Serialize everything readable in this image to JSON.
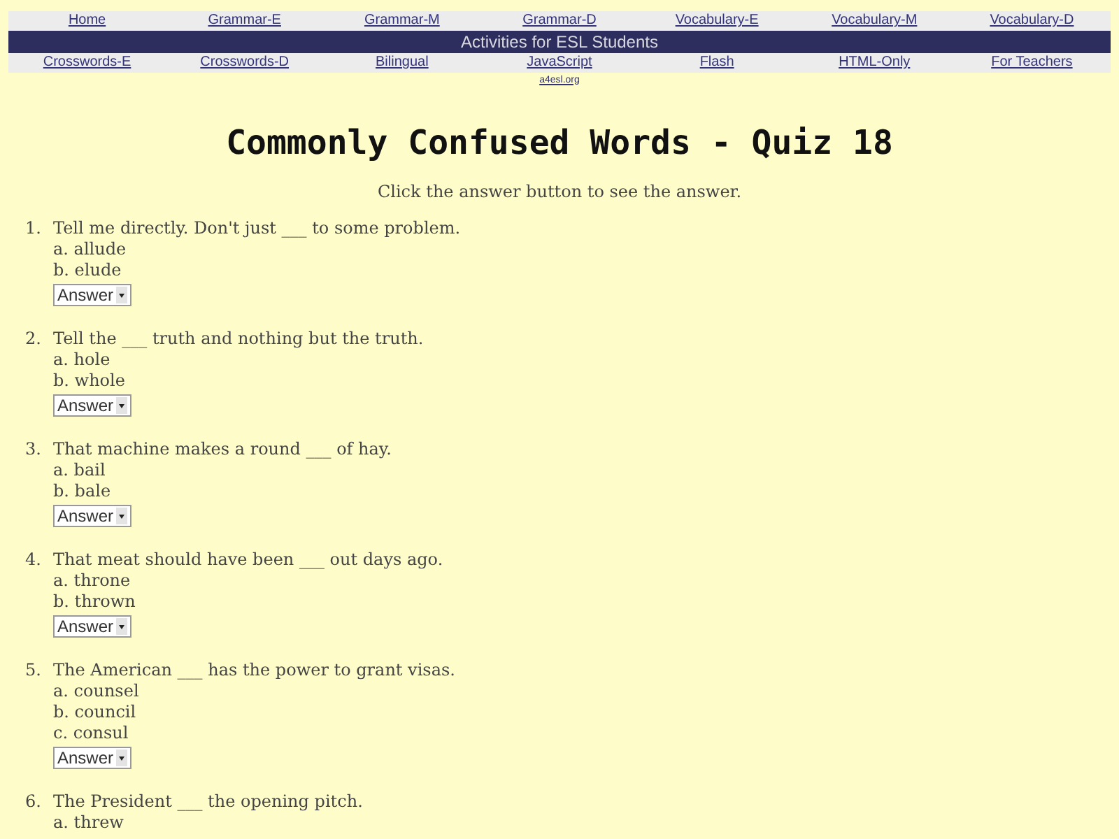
{
  "nav_top": [
    "Home",
    "Grammar-E",
    "Grammar-M",
    "Grammar-D",
    "Vocabulary-E",
    "Vocabulary-M",
    "Vocabulary-D"
  ],
  "banner": "Activities for ESL Students",
  "nav_bottom": [
    "Crosswords-E",
    "Crosswords-D",
    "Bilingual",
    "JavaScript",
    "Flash",
    "HTML-Only",
    "For Teachers"
  ],
  "site_link": "a4esl.org",
  "title": "Commonly Confused Words - Quiz 18",
  "instructions": "Click the answer button to see the answer.",
  "questions": [
    {
      "number": "1.",
      "text": "Tell me directly. Don't just ___ to some problem.",
      "options": [
        "a. allude",
        "b. elude"
      ],
      "answer_button": "Answer"
    },
    {
      "number": "2.",
      "text": "Tell the ___ truth and nothing but the truth.",
      "options": [
        "a. hole",
        "b. whole"
      ],
      "answer_button": "Answer"
    },
    {
      "number": "3.",
      "text": "That machine makes a round ___ of hay.",
      "options": [
        "a. bail",
        "b. bale"
      ],
      "answer_button": "Answer"
    },
    {
      "number": "4.",
      "text": "That meat should have been ___ out days ago.",
      "options": [
        "a. throne",
        "b. thrown"
      ],
      "answer_button": "Answer"
    },
    {
      "number": "5.",
      "text": "The American ___ has the power to grant visas.",
      "options": [
        "a. counsel",
        "b. council",
        "c. consul"
      ],
      "answer_button": "Answer"
    },
    {
      "number": "6.",
      "text": "The President ___ the opening pitch.",
      "options": [
        "a. threw"
      ]
    }
  ]
}
